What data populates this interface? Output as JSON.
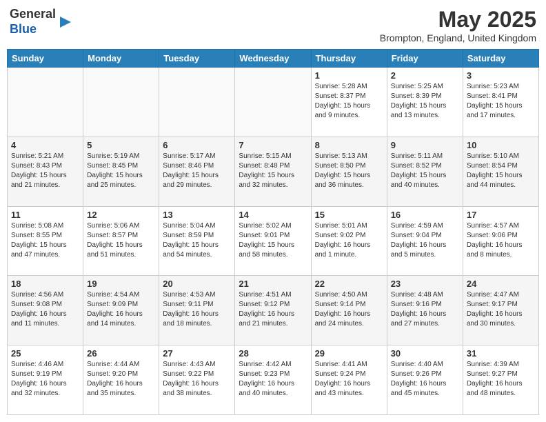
{
  "header": {
    "logo_line1": "General",
    "logo_line2": "Blue",
    "month_title": "May 2025",
    "location": "Brompton, England, United Kingdom"
  },
  "days_of_week": [
    "Sunday",
    "Monday",
    "Tuesday",
    "Wednesday",
    "Thursday",
    "Friday",
    "Saturday"
  ],
  "weeks": [
    [
      {
        "day": "",
        "info": ""
      },
      {
        "day": "",
        "info": ""
      },
      {
        "day": "",
        "info": ""
      },
      {
        "day": "",
        "info": ""
      },
      {
        "day": "1",
        "info": "Sunrise: 5:28 AM\nSunset: 8:37 PM\nDaylight: 15 hours\nand 9 minutes."
      },
      {
        "day": "2",
        "info": "Sunrise: 5:25 AM\nSunset: 8:39 PM\nDaylight: 15 hours\nand 13 minutes."
      },
      {
        "day": "3",
        "info": "Sunrise: 5:23 AM\nSunset: 8:41 PM\nDaylight: 15 hours\nand 17 minutes."
      }
    ],
    [
      {
        "day": "4",
        "info": "Sunrise: 5:21 AM\nSunset: 8:43 PM\nDaylight: 15 hours\nand 21 minutes."
      },
      {
        "day": "5",
        "info": "Sunrise: 5:19 AM\nSunset: 8:45 PM\nDaylight: 15 hours\nand 25 minutes."
      },
      {
        "day": "6",
        "info": "Sunrise: 5:17 AM\nSunset: 8:46 PM\nDaylight: 15 hours\nand 29 minutes."
      },
      {
        "day": "7",
        "info": "Sunrise: 5:15 AM\nSunset: 8:48 PM\nDaylight: 15 hours\nand 32 minutes."
      },
      {
        "day": "8",
        "info": "Sunrise: 5:13 AM\nSunset: 8:50 PM\nDaylight: 15 hours\nand 36 minutes."
      },
      {
        "day": "9",
        "info": "Sunrise: 5:11 AM\nSunset: 8:52 PM\nDaylight: 15 hours\nand 40 minutes."
      },
      {
        "day": "10",
        "info": "Sunrise: 5:10 AM\nSunset: 8:54 PM\nDaylight: 15 hours\nand 44 minutes."
      }
    ],
    [
      {
        "day": "11",
        "info": "Sunrise: 5:08 AM\nSunset: 8:55 PM\nDaylight: 15 hours\nand 47 minutes."
      },
      {
        "day": "12",
        "info": "Sunrise: 5:06 AM\nSunset: 8:57 PM\nDaylight: 15 hours\nand 51 minutes."
      },
      {
        "day": "13",
        "info": "Sunrise: 5:04 AM\nSunset: 8:59 PM\nDaylight: 15 hours\nand 54 minutes."
      },
      {
        "day": "14",
        "info": "Sunrise: 5:02 AM\nSunset: 9:01 PM\nDaylight: 15 hours\nand 58 minutes."
      },
      {
        "day": "15",
        "info": "Sunrise: 5:01 AM\nSunset: 9:02 PM\nDaylight: 16 hours\nand 1 minute."
      },
      {
        "day": "16",
        "info": "Sunrise: 4:59 AM\nSunset: 9:04 PM\nDaylight: 16 hours\nand 5 minutes."
      },
      {
        "day": "17",
        "info": "Sunrise: 4:57 AM\nSunset: 9:06 PM\nDaylight: 16 hours\nand 8 minutes."
      }
    ],
    [
      {
        "day": "18",
        "info": "Sunrise: 4:56 AM\nSunset: 9:08 PM\nDaylight: 16 hours\nand 11 minutes."
      },
      {
        "day": "19",
        "info": "Sunrise: 4:54 AM\nSunset: 9:09 PM\nDaylight: 16 hours\nand 14 minutes."
      },
      {
        "day": "20",
        "info": "Sunrise: 4:53 AM\nSunset: 9:11 PM\nDaylight: 16 hours\nand 18 minutes."
      },
      {
        "day": "21",
        "info": "Sunrise: 4:51 AM\nSunset: 9:12 PM\nDaylight: 16 hours\nand 21 minutes."
      },
      {
        "day": "22",
        "info": "Sunrise: 4:50 AM\nSunset: 9:14 PM\nDaylight: 16 hours\nand 24 minutes."
      },
      {
        "day": "23",
        "info": "Sunrise: 4:48 AM\nSunset: 9:16 PM\nDaylight: 16 hours\nand 27 minutes."
      },
      {
        "day": "24",
        "info": "Sunrise: 4:47 AM\nSunset: 9:17 PM\nDaylight: 16 hours\nand 30 minutes."
      }
    ],
    [
      {
        "day": "25",
        "info": "Sunrise: 4:46 AM\nSunset: 9:19 PM\nDaylight: 16 hours\nand 32 minutes."
      },
      {
        "day": "26",
        "info": "Sunrise: 4:44 AM\nSunset: 9:20 PM\nDaylight: 16 hours\nand 35 minutes."
      },
      {
        "day": "27",
        "info": "Sunrise: 4:43 AM\nSunset: 9:22 PM\nDaylight: 16 hours\nand 38 minutes."
      },
      {
        "day": "28",
        "info": "Sunrise: 4:42 AM\nSunset: 9:23 PM\nDaylight: 16 hours\nand 40 minutes."
      },
      {
        "day": "29",
        "info": "Sunrise: 4:41 AM\nSunset: 9:24 PM\nDaylight: 16 hours\nand 43 minutes."
      },
      {
        "day": "30",
        "info": "Sunrise: 4:40 AM\nSunset: 9:26 PM\nDaylight: 16 hours\nand 45 minutes."
      },
      {
        "day": "31",
        "info": "Sunrise: 4:39 AM\nSunset: 9:27 PM\nDaylight: 16 hours\nand 48 minutes."
      }
    ]
  ]
}
